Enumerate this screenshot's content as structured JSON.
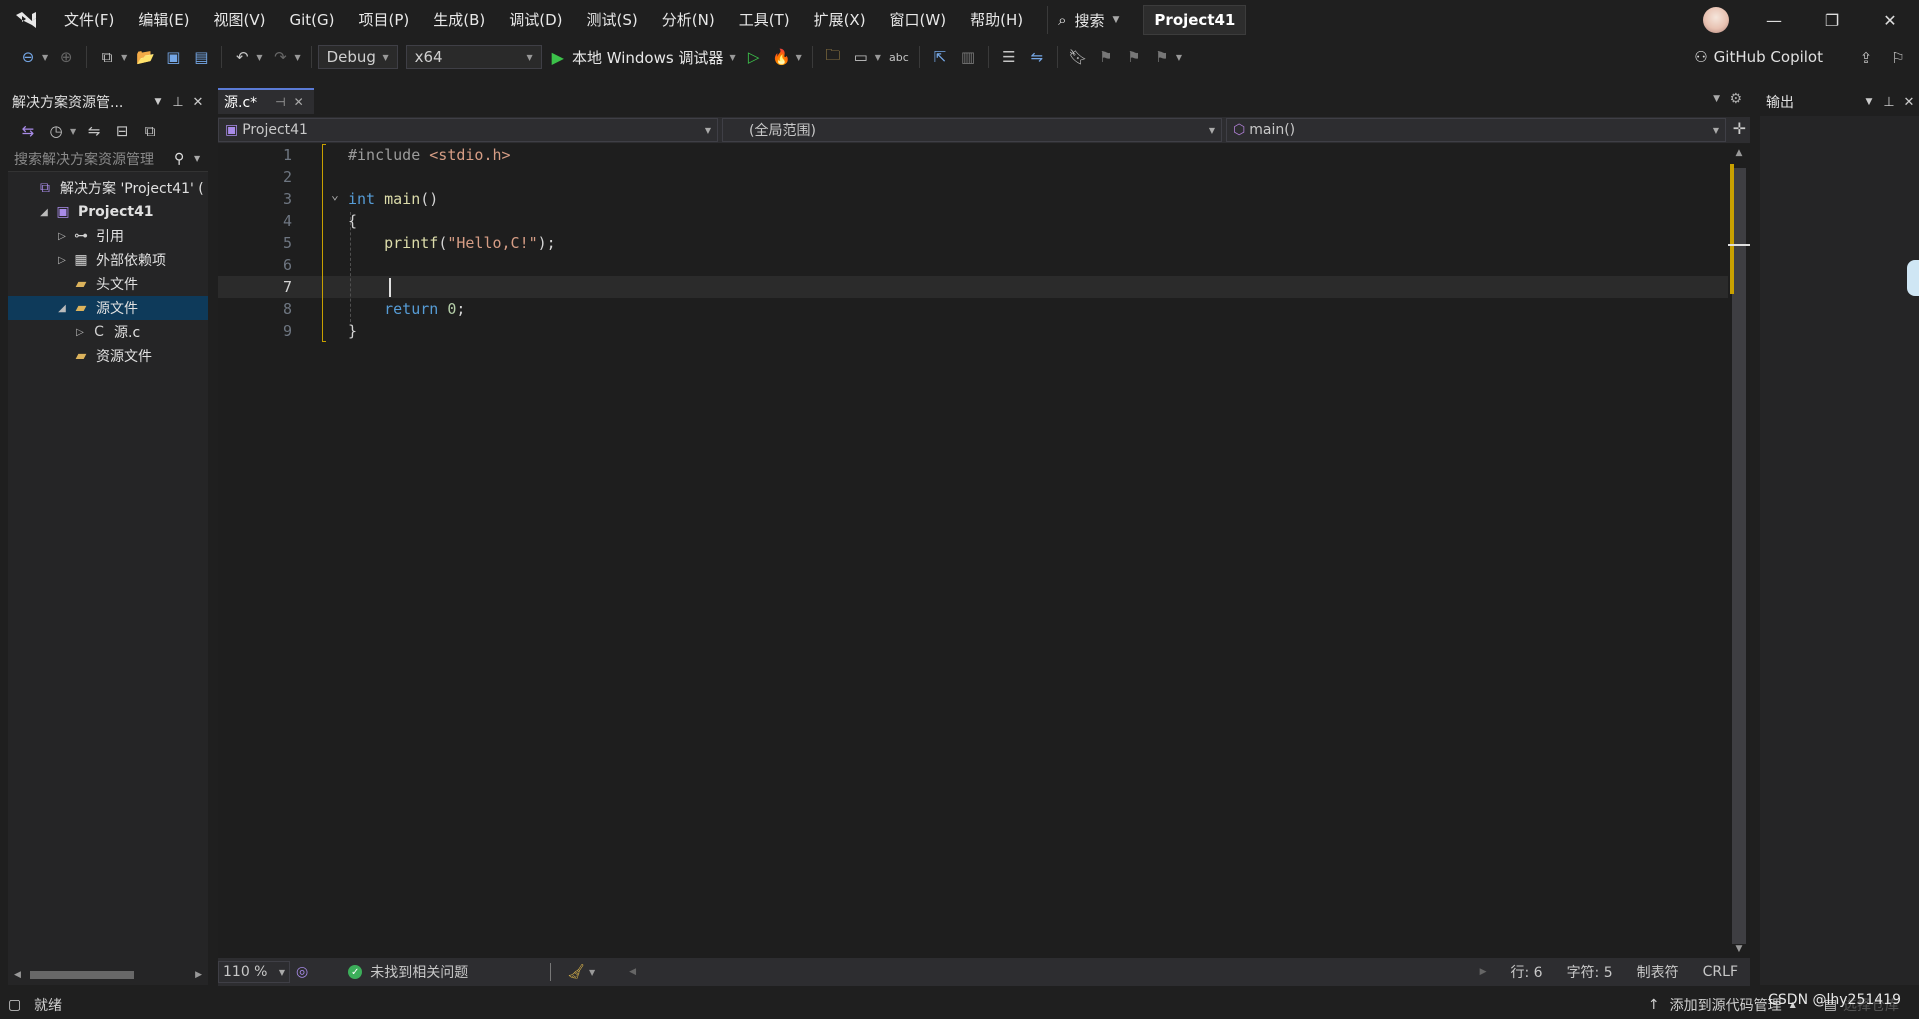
{
  "menu": {
    "items": [
      "文件(F)",
      "编辑(E)",
      "视图(V)",
      "Git(G)",
      "项目(P)",
      "生成(B)",
      "调试(D)",
      "测试(S)",
      "分析(N)",
      "工具(T)",
      "扩展(X)",
      "窗口(W)",
      "帮助(H)"
    ],
    "search_label": "搜索",
    "project_name": "Project41"
  },
  "toolbar": {
    "config": "Debug",
    "platform": "x64",
    "run_label": "本地 Windows 调试器",
    "copilot_label": "GitHub Copilot"
  },
  "solution_explorer": {
    "title": "解决方案资源管...",
    "search_placeholder": "搜索解决方案资源管理",
    "tree": [
      {
        "label": "解决方案 'Project41' (",
        "indent": 0,
        "arrow": "",
        "icon": "solution-icon",
        "bold": false,
        "selected": false
      },
      {
        "label": "Project41",
        "indent": 1,
        "arrow": "◢",
        "icon": "project-icon",
        "bold": true,
        "selected": false
      },
      {
        "label": "引用",
        "indent": 2,
        "arrow": "▷",
        "icon": "references-icon",
        "bold": false,
        "selected": false
      },
      {
        "label": "外部依赖项",
        "indent": 2,
        "arrow": "▷",
        "icon": "external-deps-icon",
        "bold": false,
        "selected": false
      },
      {
        "label": "头文件",
        "indent": 2,
        "arrow": "",
        "icon": "folder-filter-icon",
        "bold": false,
        "selected": false
      },
      {
        "label": "源文件",
        "indent": 2,
        "arrow": "◢",
        "icon": "folder-filter-icon",
        "bold": false,
        "selected": true
      },
      {
        "label": "源.c",
        "indent": 3,
        "arrow": "▷",
        "icon": "c-file-icon",
        "bold": false,
        "selected": false
      },
      {
        "label": "资源文件",
        "indent": 2,
        "arrow": "",
        "icon": "folder-filter-icon",
        "bold": false,
        "selected": false
      }
    ]
  },
  "editor": {
    "tab_label": "源.c*",
    "nav_project": "Project41",
    "nav_scope": "(全局范围)",
    "nav_member": "main()",
    "current_line": 7,
    "lines": [
      {
        "n": "1",
        "tokens": [
          {
            "t": "#include ",
            "c": "pp"
          },
          {
            "t": "<stdio.h>",
            "c": "inc"
          }
        ]
      },
      {
        "n": "2",
        "tokens": []
      },
      {
        "n": "3",
        "tokens": [
          {
            "t": "int ",
            "c": "kw"
          },
          {
            "t": "main",
            "c": "fn"
          },
          {
            "t": "()",
            "c": "plain"
          }
        ]
      },
      {
        "n": "4",
        "tokens": [
          {
            "t": "{",
            "c": "plain"
          }
        ]
      },
      {
        "n": "5",
        "tokens": [
          {
            "t": "    ",
            "c": "plain"
          },
          {
            "t": "printf",
            "c": "fn"
          },
          {
            "t": "(",
            "c": "plain"
          },
          {
            "t": "\"Hello,C!\"",
            "c": "str"
          },
          {
            "t": ");",
            "c": "plain"
          }
        ]
      },
      {
        "n": "6",
        "tokens": []
      },
      {
        "n": "7",
        "tokens": []
      },
      {
        "n": "8",
        "tokens": [
          {
            "t": "    ",
            "c": "plain"
          },
          {
            "t": "return ",
            "c": "kw"
          },
          {
            "t": "0",
            "c": "num"
          },
          {
            "t": ";",
            "c": "plain"
          }
        ]
      },
      {
        "n": "9",
        "tokens": [
          {
            "t": "}",
            "c": "plain"
          }
        ]
      }
    ],
    "zoom": "110 %",
    "issues": "未找到相关问题",
    "line_info": "行: 6",
    "char_info": "字符: 5",
    "tab_mode": "制表符",
    "eol": "CRLF"
  },
  "output": {
    "title": "输出"
  },
  "statusbar": {
    "ready": "就绪",
    "source_control": "添加到源代码管理",
    "repo": "选择仓库",
    "watermark": "CSDN @lhy251419"
  }
}
